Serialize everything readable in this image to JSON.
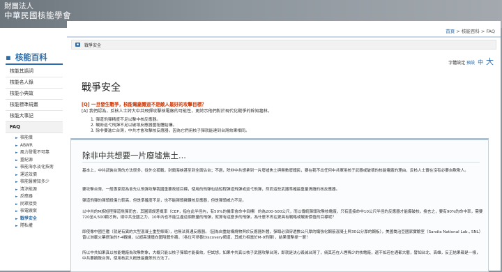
{
  "banner": {
    "logo_line1": "財團法人",
    "logo_line2": "中華民國核能學會"
  },
  "sidebar": {
    "title": "核能百科",
    "items": [
      {
        "label": "核能其語詞"
      },
      {
        "label": "核能名人錄"
      },
      {
        "label": "核能小典故"
      },
      {
        "label": "核能標準規畫"
      },
      {
        "label": "核能大事記"
      }
    ],
    "faq_label": "FAQ",
    "sub_items": [
      {
        "label": "核能傑"
      },
      {
        "label": "ABWR"
      },
      {
        "label": "風力發電不可靠"
      },
      {
        "label": "重紀源"
      },
      {
        "label": "核能海水淡化技術"
      },
      {
        "label": "運送效價"
      },
      {
        "label": "核能醫療知多少"
      },
      {
        "label": "清涼能源"
      },
      {
        "label": "反應器"
      },
      {
        "label": "民眾接受"
      },
      {
        "label": "核電廠案"
      },
      {
        "label": "戰爭安全"
      },
      {
        "label": "隱私權"
      }
    ]
  },
  "main": {
    "breadcrumb": {
      "home": "首頁",
      "sep1": " > ",
      "mid": "核能百科",
      "sep2": " > ",
      "last": "FAQ"
    },
    "section_label": "戰爭安全",
    "font_size": {
      "label": "字體設定",
      "small": "預設",
      "mid": "中",
      "big": "大"
    },
    "title": "戰爭安全",
    "question": "[Q] 一旦發生戰爭，核能電廠難道不是敵人最好的攻擊目標？",
    "answer": "[A] 我們認為，反核人士誇大中共飛彈攻擊核電廠的可能性，更誇示他們對於現代化戰爭的幹知趨林。",
    "list": [
      "1. 彈道飛彈精度不足以擊中核反應器。",
      "2. 戰術巡弋飛彈不足以破壞反應器圍阻體結構。",
      "3. 除非要進亡台灣，中共才會攻擊核反應器，因為它們用核子彈就能達到台灣效果相同。"
    ],
    "box": {
      "title": "除非中共想要一片廢墟焦土...",
      "paragraphs": [
        "基本上，中共武裝台灣的方法很多，從外交孤戰，封鎖海峽甚至到全面佔台；不過，除非中共想拿到一片廢墟焦土與無數廢鐵民，要在我不出任何中共軍用核子武器或破壞的核能電廠的理由，反核人士實在沒有必要自欺欺人。",
        "要攻擊台灣，一般專家認為會先以飛彈攻擊我國重要政經目標，使用的飛彈包括短程彈道飛彈或巡弋飛彈，然而這些武器準確最重量清讀的核反應器。",
        "彈道飛彈的彈頭殺傷力較高，但是準確度不足，也不能彈頭擁鑽核反應器，但是彈頭威力不足。",
        "以中共的M族短程彈道飛彈而言，其圓周誤差概率（CEP，指在此半徑內，有50%的機率會命中目標）約為200-500公尺，而以傳統彈頭攻擊核電廠，只有直接命中10公尺半徑的反應器才能爆破核，換言之，要有90%的命中率，需要720至4,500顆才夠，總中共全國之力，10年內也不能生產這個數量的飛彈，就算有這麼多的飛彈，為什麼不丟在更具有戰略或戰術價值的目標呢？",
        "即使像中國巨艦（就是有異的大型混凝土重型條築），也無法貫通反應器。（因為自重結構燒物與於反應器外體，彈頭必須穿透數公尺厚的鐵強化鋼筋混凝土與30公分厚的鋼板），美國喬治亞國家實驗室（Sandia National Lab., SNL）曾以洲載火藥燃油的F-4戰機，以超高速撞向圍阻體外牆，（各位可參觀Discovery頻道，其威力相當於M-9飛彈），結果僅擊掉一層！",
        "所以中共如果真以核能電廠為攻擊對象，大概只能以核子彈頭才能奏效，但試想，如果中共真以核子武器攻擊台灣，即就是決心毀滅台灣了，倘其若在人煙稀少的核電廠，還不如若在通都大衢，譬如台北、高雄，反正結果都是一樣，中共要攝敵台灣，使用核武大概是最蠢笨的方法了。"
      ]
    }
  }
}
